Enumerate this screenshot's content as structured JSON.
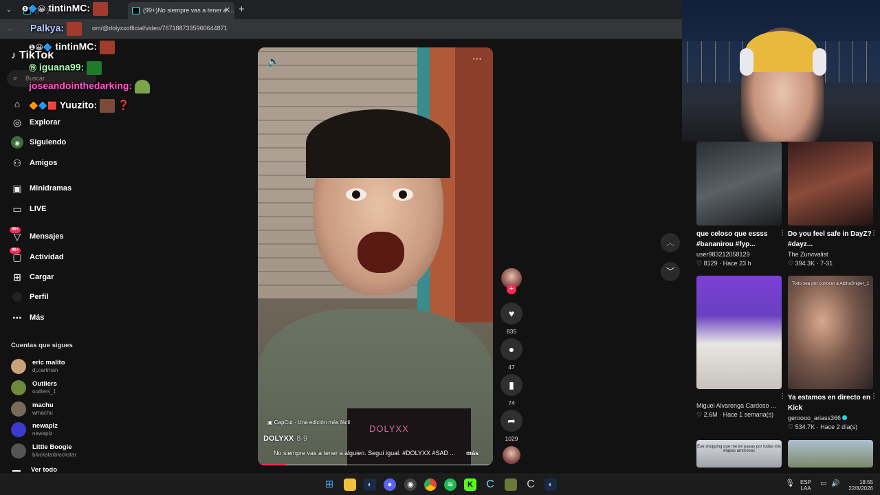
{
  "browser": {
    "tabs": [
      {
        "label": "(99+) Sn…"
      },
      {
        "label": "(99+)No siempre vas a tener a …"
      }
    ],
    "url": "om/@dolyxxofficial/video/7671887335960644871",
    "new_tab_glyph": "+",
    "close_glyph": "✕"
  },
  "chat": [
    {
      "user": "tintinMC:",
      "badges": "❶🔷😀"
    },
    {
      "user": "Palkya:",
      "badges": ""
    },
    {
      "user": "tintinMC:",
      "badges": "❶😀🔷"
    },
    {
      "user": "iguana99:",
      "badges": "⑲"
    },
    {
      "user": "joseandointhedarking:",
      "badges": ""
    },
    {
      "user": "Yuuzito:",
      "badges": "🔶🔷🟥",
      "trailing": "❓"
    }
  ],
  "sidebar": {
    "logo": "TikTok",
    "search_placeholder": "Buscar",
    "items": [
      {
        "label": "Explorar",
        "icon": "compass-icon"
      },
      {
        "label": "Siguiendo",
        "icon": "following-icon"
      },
      {
        "label": "Amigos",
        "icon": "friends-icon"
      },
      {
        "label": "Minidramas",
        "icon": "minidramas-icon"
      },
      {
        "label": "LIVE",
        "icon": "live-icon"
      },
      {
        "label": "Mensajes",
        "icon": "messages-icon",
        "badge": "99+"
      },
      {
        "label": "Actividad",
        "icon": "activity-icon",
        "badge": "99+"
      },
      {
        "label": "Cargar",
        "icon": "upload-icon"
      },
      {
        "label": "Perfil",
        "icon": "profile-icon"
      },
      {
        "label": "Más",
        "icon": "more-icon"
      }
    ],
    "following_title": "Cuentas que sigues",
    "following": [
      {
        "name": "eric malito",
        "handle": "dj.cartman",
        "color": "#c9a27a"
      },
      {
        "name": "Outliers",
        "handle": "outliers_1",
        "color": "#6d8a3a"
      },
      {
        "name": "machu",
        "handle": "wmachu",
        "color": "#7a6a5a"
      },
      {
        "name": "newaplz",
        "handle": "newaplz",
        "color": "#3a3acf"
      },
      {
        "name": "Little Boogie",
        "handle": "blockstarblockstar",
        "color": "#555555"
      }
    ],
    "see_all": "Ver todo"
  },
  "video": {
    "edit_label": "CapCut · Una edición más fácil",
    "author": "DOLYXX",
    "date": "8-9",
    "description": "No siempre vas a tener a alguien. Seguí igual. #DOLYXX #SAD ...",
    "more_label": "más",
    "print_text": "DOLYXX",
    "progress": 0.12
  },
  "actions": {
    "likes": "835",
    "comments": "47",
    "saves": "74",
    "shares": "1029"
  },
  "feed": [
    {
      "title": "que celoso que essss #bananirou #fyp...",
      "user": "user983212058129",
      "stats": "♡ 8129 · Hace 23 h",
      "verified": false
    },
    {
      "title": "Do you feel safe in DayZ? #dayz...",
      "user": "The Zurvivalist",
      "stats": "♡ 394.3K · 7-31",
      "verified": false
    },
    {
      "title": "",
      "user": "Miguel Alvarenga Cardoso ...",
      "stats": "♡ 2.6M · Hace 1 semana(s)",
      "verified": false
    },
    {
      "title": "Ya estamos en directo en Kick",
      "user": "geroooo_ariass366",
      "stats": "♡ 534.7K · Hace 2 día(s)",
      "verified": true,
      "thumb_text": "Todo sea por conocer a AlphaSniper_1"
    },
    {
      "title": "",
      "user": "",
      "stats": "",
      "thumb_text": "Ese shopping que me iré pasas por todas mis etapas amorosas"
    },
    {
      "title": "",
      "user": "",
      "stats": ""
    }
  ],
  "taskbar": {
    "lang_top": "ESP",
    "lang_bottom": "LAA",
    "time": "18:55",
    "date": "22/8/2026"
  },
  "colors": {
    "accent": "#fe2c55",
    "background": "#121212"
  }
}
